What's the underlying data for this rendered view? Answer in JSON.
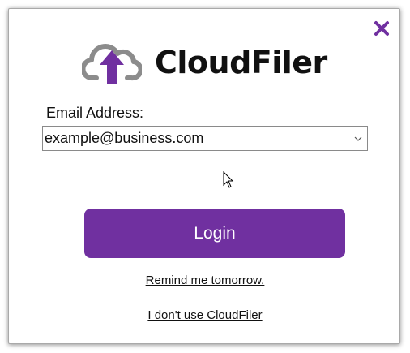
{
  "app": {
    "logo_text": "CloudFiler",
    "logo_icon": "cloud-upload-icon"
  },
  "colors": {
    "accent": "#7030a0",
    "cloud_gray": "#8c8c8c",
    "text": "#111111"
  },
  "form": {
    "email_label": "Email Address:",
    "email_value": "example@business.com"
  },
  "buttons": {
    "login_label": "Login",
    "close_icon": "close-icon"
  },
  "links": {
    "remind": "Remind me tomorrow.",
    "dont_use": "I don't use CloudFiler"
  }
}
